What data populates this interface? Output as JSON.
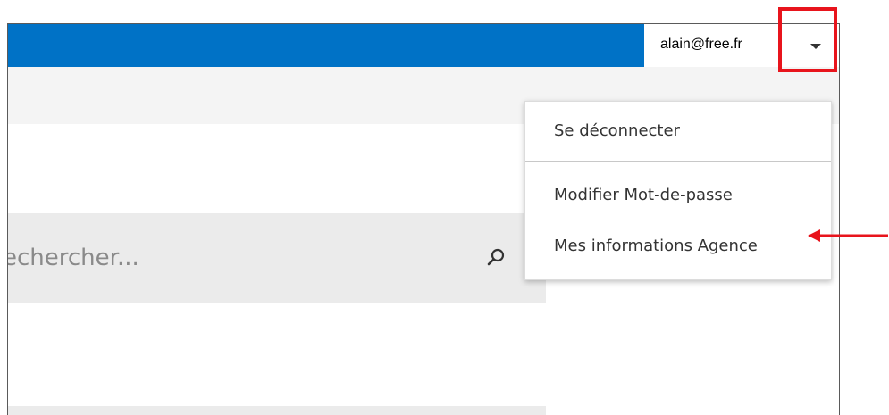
{
  "header": {
    "user_email": "alain@free.fr",
    "dropdown_icon": "caret-down-icon"
  },
  "user_menu": {
    "items": [
      {
        "label": "Se déconnecter"
      },
      {
        "label": "Modifier Mot-de-passe"
      },
      {
        "label": "Mes informations Agence"
      }
    ]
  },
  "search": {
    "placeholder": "echercher...",
    "icon": "search-icon"
  },
  "colors": {
    "topbar": "#0072c6",
    "annotation": "#e8141c",
    "panel_gray": "#ebebeb"
  }
}
